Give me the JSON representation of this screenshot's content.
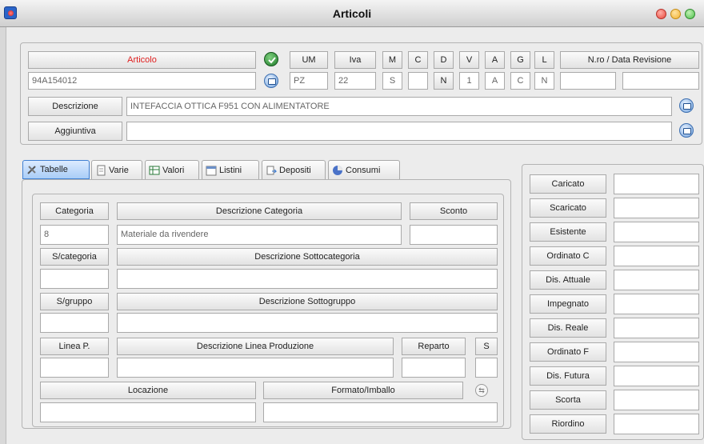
{
  "window": {
    "title": "Articoli"
  },
  "header": {
    "articolo_label": "Articolo",
    "articolo_value": "94A154012",
    "um_label": "UM",
    "um_value": "PZ",
    "iva_label": "Iva",
    "iva_value": "22",
    "m_label": "M",
    "m_value": "S",
    "c_label": "C",
    "c_value": "",
    "d_label": "D",
    "d_value": "N",
    "v_label": "V",
    "v_value": "1",
    "a_label": "A",
    "a_value": "A",
    "g_label": "G",
    "g_value": "C",
    "l_label": "L",
    "l_value": "N",
    "revision_label": "N.ro / Data Revisione",
    "revision_number": "",
    "revision_date": "",
    "descrizione_label": "Descrizione",
    "descrizione_value": "INTEFACCIA OTTICA F951 CON ALIMENTATORE",
    "aggiuntiva_label": "Aggiuntiva",
    "aggiuntiva_value": ""
  },
  "tabs": [
    {
      "label": "Tabelle",
      "icon": "tools-icon",
      "active": true
    },
    {
      "label": "Varie",
      "icon": "document-icon"
    },
    {
      "label": "Valori",
      "icon": "table-icon"
    },
    {
      "label": "Listini",
      "icon": "calendar-icon"
    },
    {
      "label": "Depositi",
      "icon": "warehouse-icon"
    },
    {
      "label": "Consumi",
      "icon": "pie-chart-icon"
    }
  ],
  "tabelle": {
    "categoria_label": "Categoria",
    "categoria_value": "8",
    "desc_categoria_label": "Descrizione Categoria",
    "desc_categoria_value": "Materiale da rivendere",
    "sconto_label": "Sconto",
    "sconto_value": "",
    "scategoria_label": "S/categoria",
    "scategoria_value": "",
    "desc_sottocategoria_label": "Descrizione Sottocategoria",
    "desc_sottocategoria_value": "",
    "sgruppo_label": "S/gruppo",
    "sgruppo_value": "",
    "desc_sottogruppo_label": "Descrizione Sottogruppo",
    "desc_sottogruppo_value": "",
    "linea_label": "Linea P.",
    "linea_value": "",
    "desc_linea_label": "Descrizione Linea Produzione",
    "desc_linea_value": "",
    "reparto_label": "Reparto",
    "reparto_value": "",
    "s_label": "S",
    "s_value": "",
    "locazione_label": "Locazione",
    "locazione_value": "",
    "formato_label": "Formato/Imballo",
    "formato_value": ""
  },
  "stock": [
    {
      "label": "Caricato",
      "value": ""
    },
    {
      "label": "Scaricato",
      "value": ""
    },
    {
      "label": "Esistente",
      "value": ""
    },
    {
      "label": "Ordinato C",
      "value": ""
    },
    {
      "label": "Dis. Attuale",
      "value": ""
    },
    {
      "label": "Impegnato",
      "value": ""
    },
    {
      "label": "Dis. Reale",
      "value": ""
    },
    {
      "label": "Ordinato F",
      "value": ""
    },
    {
      "label": "Dis. Futura",
      "value": ""
    },
    {
      "label": "Scorta",
      "value": ""
    },
    {
      "label": "Riordino",
      "value": ""
    }
  ],
  "colors": {
    "articolo_label": "#e02020",
    "active_tab": "#a9cdf7",
    "close": "#e8463a",
    "minimize": "#f2b230",
    "zoom": "#4cc04a"
  }
}
